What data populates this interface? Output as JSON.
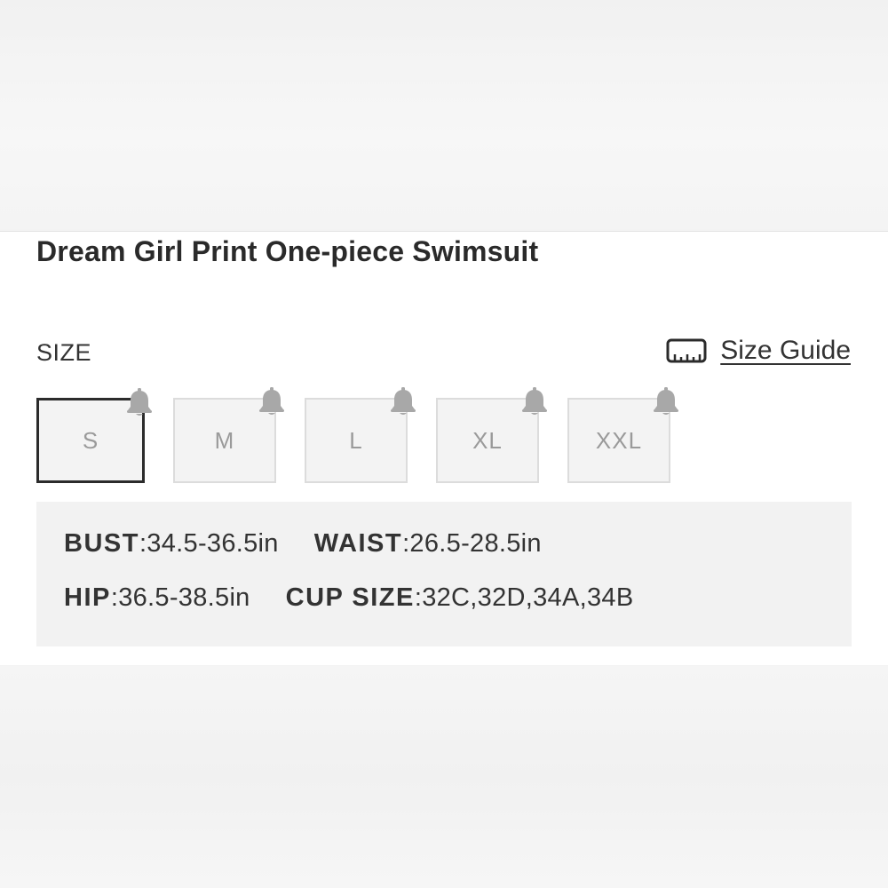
{
  "product": {
    "title": "Dream Girl Print One-piece Swimsuit"
  },
  "size_section": {
    "label": "SIZE",
    "guide_label": "Size Guide",
    "options": [
      {
        "label": "S",
        "selected": true
      },
      {
        "label": "M",
        "selected": false
      },
      {
        "label": "L",
        "selected": false
      },
      {
        "label": "XL",
        "selected": false
      },
      {
        "label": "XXL",
        "selected": false
      }
    ]
  },
  "measurements": {
    "bust": {
      "label": "BUST",
      "value": ":34.5-36.5in"
    },
    "waist": {
      "label": "WAIST",
      "value": ":26.5-28.5in"
    },
    "hip": {
      "label": "HIP",
      "value": ":36.5-38.5in"
    },
    "cup_size": {
      "label": "CUP SIZE",
      "value": ":32C,32D,34A,34B"
    }
  },
  "icons": {
    "ruler": "ruler-icon",
    "bell": "bell-icon"
  },
  "colors": {
    "selected_border": "#2b2b2b",
    "bell": "#a8a8a8",
    "text": "#333333"
  }
}
